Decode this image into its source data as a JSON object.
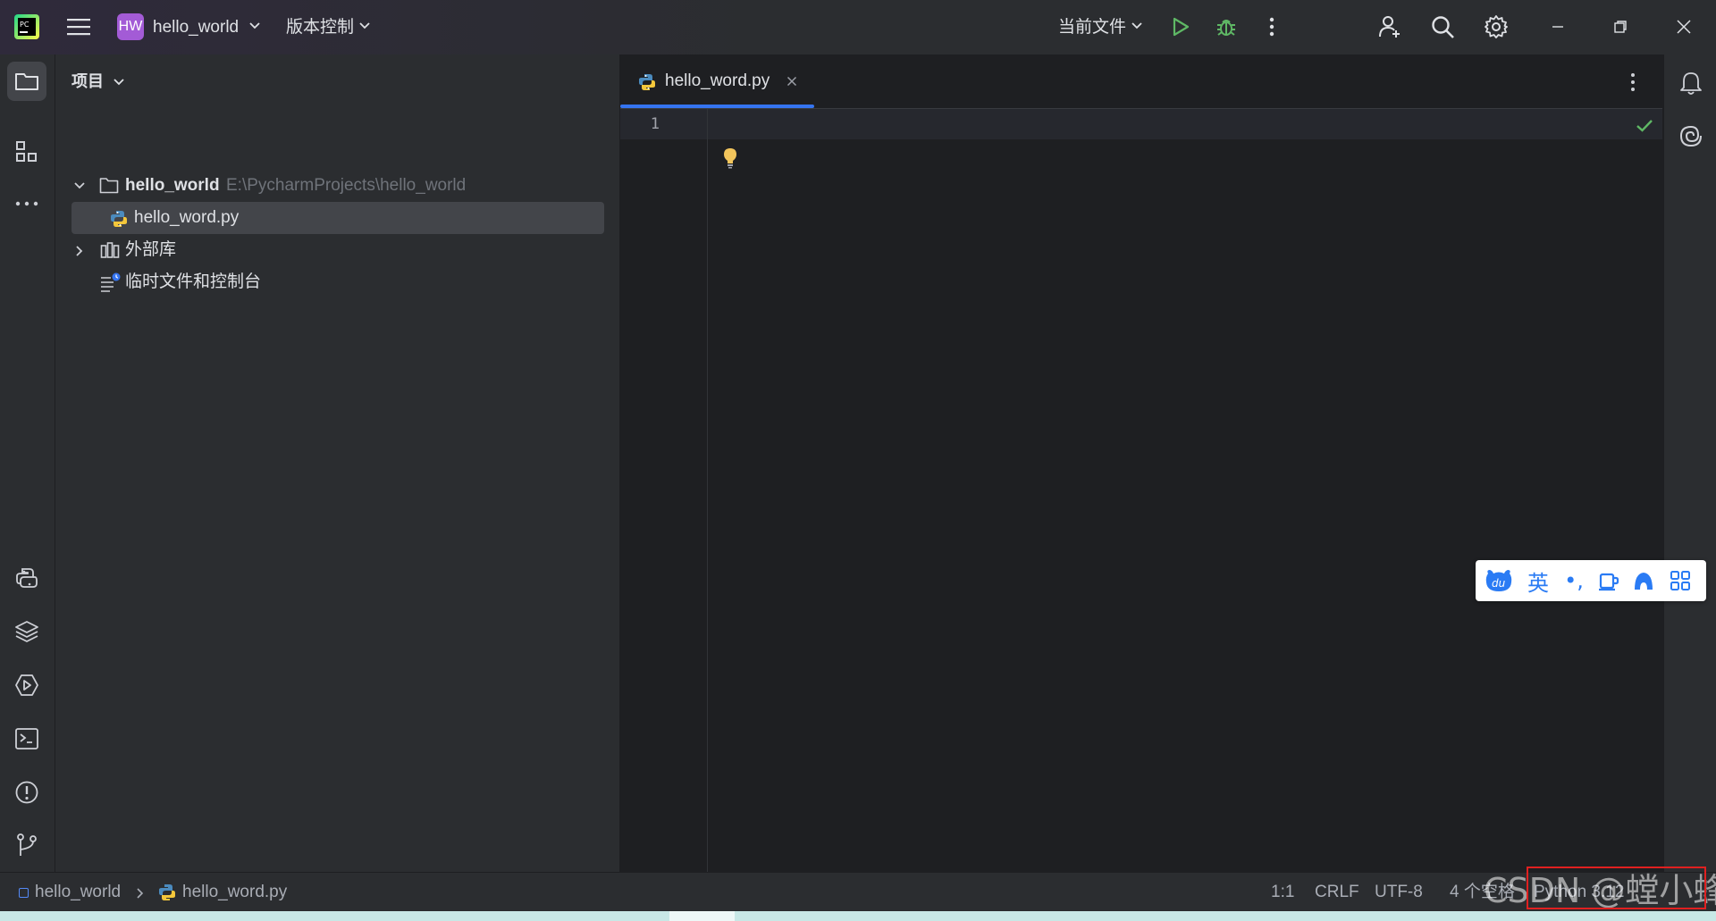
{
  "titlebar": {
    "project_badge": "HW",
    "project_name": "hello_world",
    "vcs_menu": "版本控制",
    "run_config": "当前文件"
  },
  "project_panel": {
    "title": "项目",
    "tree": {
      "root_name": "hello_world",
      "root_path": "E:\\PycharmProjects\\hello_world",
      "file": "hello_word.py",
      "external_libs": "外部库",
      "scratches": "临时文件和控制台"
    }
  },
  "editor": {
    "tab_label": "hello_word.py",
    "line_numbers": [
      "1"
    ]
  },
  "statusbar": {
    "breadcrumb_project": "hello_world",
    "breadcrumb_file": "hello_word.py",
    "position": "1:1",
    "line_separator": "CRLF",
    "encoding": "UTF-8",
    "indent": "4 个空格",
    "interpreter": "Python 3.12"
  },
  "ime": {
    "lang": "英",
    "punct": "•,"
  },
  "watermark": "CSDN @螳小蜂",
  "colors": {
    "accent": "#3574f0",
    "run_green": "#5fb865",
    "badge_purple": "#a35bd6",
    "ime_blue": "#2a7bf4",
    "highlight_box": "#e02020"
  }
}
